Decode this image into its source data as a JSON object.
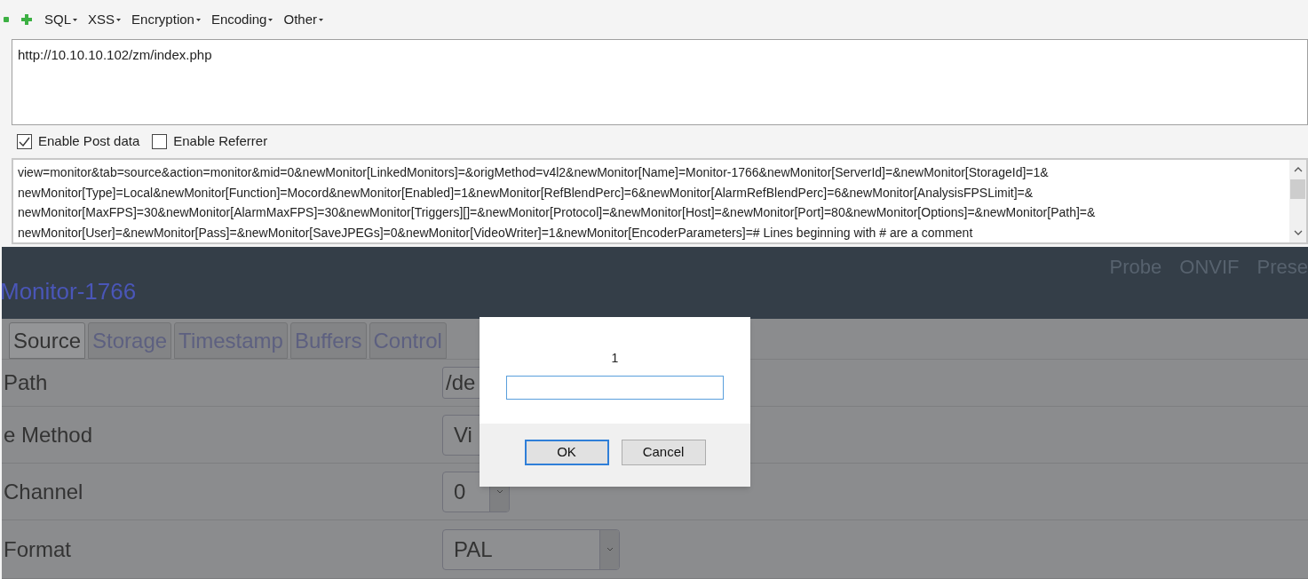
{
  "toolbar": {
    "menus": [
      {
        "label": "SQL"
      },
      {
        "label": "XSS"
      },
      {
        "label": "Encryption"
      },
      {
        "label": "Encoding"
      },
      {
        "label": "Other"
      }
    ]
  },
  "url": {
    "value": "http://10.10.10.102/zm/index.php"
  },
  "options": [
    {
      "label": "Enable Post data",
      "checked": true
    },
    {
      "label": "Enable Referrer",
      "checked": false
    }
  ],
  "post_data": {
    "lines": [
      "view=monitor&tab=source&action=monitor&mid=0&newMonitor[LinkedMonitors]=&origMethod=v4l2&newMonitor[Name]=Monitor-1766&newMonitor[ServerId]=&newMonitor[StorageId]=1&",
      "newMonitor[Type]=Local&newMonitor[Function]=Mocord&newMonitor[Enabled]=1&newMonitor[RefBlendPerc]=6&newMonitor[AlarmRefBlendPerc]=6&newMonitor[AnalysisFPSLimit]=&",
      "newMonitor[MaxFPS]=30&newMonitor[AlarmMaxFPS]=30&newMonitor[Triggers][]=&newMonitor[Protocol]=&newMonitor[Host]=&newMonitor[Port]=80&newMonitor[Options]=&newMonitor[Path]=&",
      "newMonitor[User]=&newMonitor[Pass]=&newMonitor[SaveJPEGs]=0&newMonitor[VideoWriter]=1&newMonitor[EncoderParameters]=# Lines beginning with # are a comment"
    ]
  },
  "page": {
    "header_links": [
      "Probe",
      "ONVIF",
      "Prese"
    ],
    "title": "Monitor-1766",
    "tabs": [
      {
        "label": "Source",
        "selected": true
      },
      {
        "label": "Storage",
        "selected": false
      },
      {
        "label": "Timestamp",
        "selected": false
      },
      {
        "label": "Buffers",
        "selected": false
      },
      {
        "label": "Control",
        "selected": false
      }
    ],
    "fields": [
      {
        "label": "Path",
        "kind": "text",
        "value": "/de"
      },
      {
        "label": "e Method",
        "kind": "select",
        "value": "Vi"
      },
      {
        "label": "Channel",
        "kind": "select",
        "value": "0"
      },
      {
        "label": "Format",
        "kind": "select",
        "value": "PAL"
      }
    ]
  },
  "dialog": {
    "message": "1",
    "buttons": [
      {
        "label": "OK",
        "focused": true
      },
      {
        "label": "Cancel",
        "focused": false
      }
    ]
  }
}
